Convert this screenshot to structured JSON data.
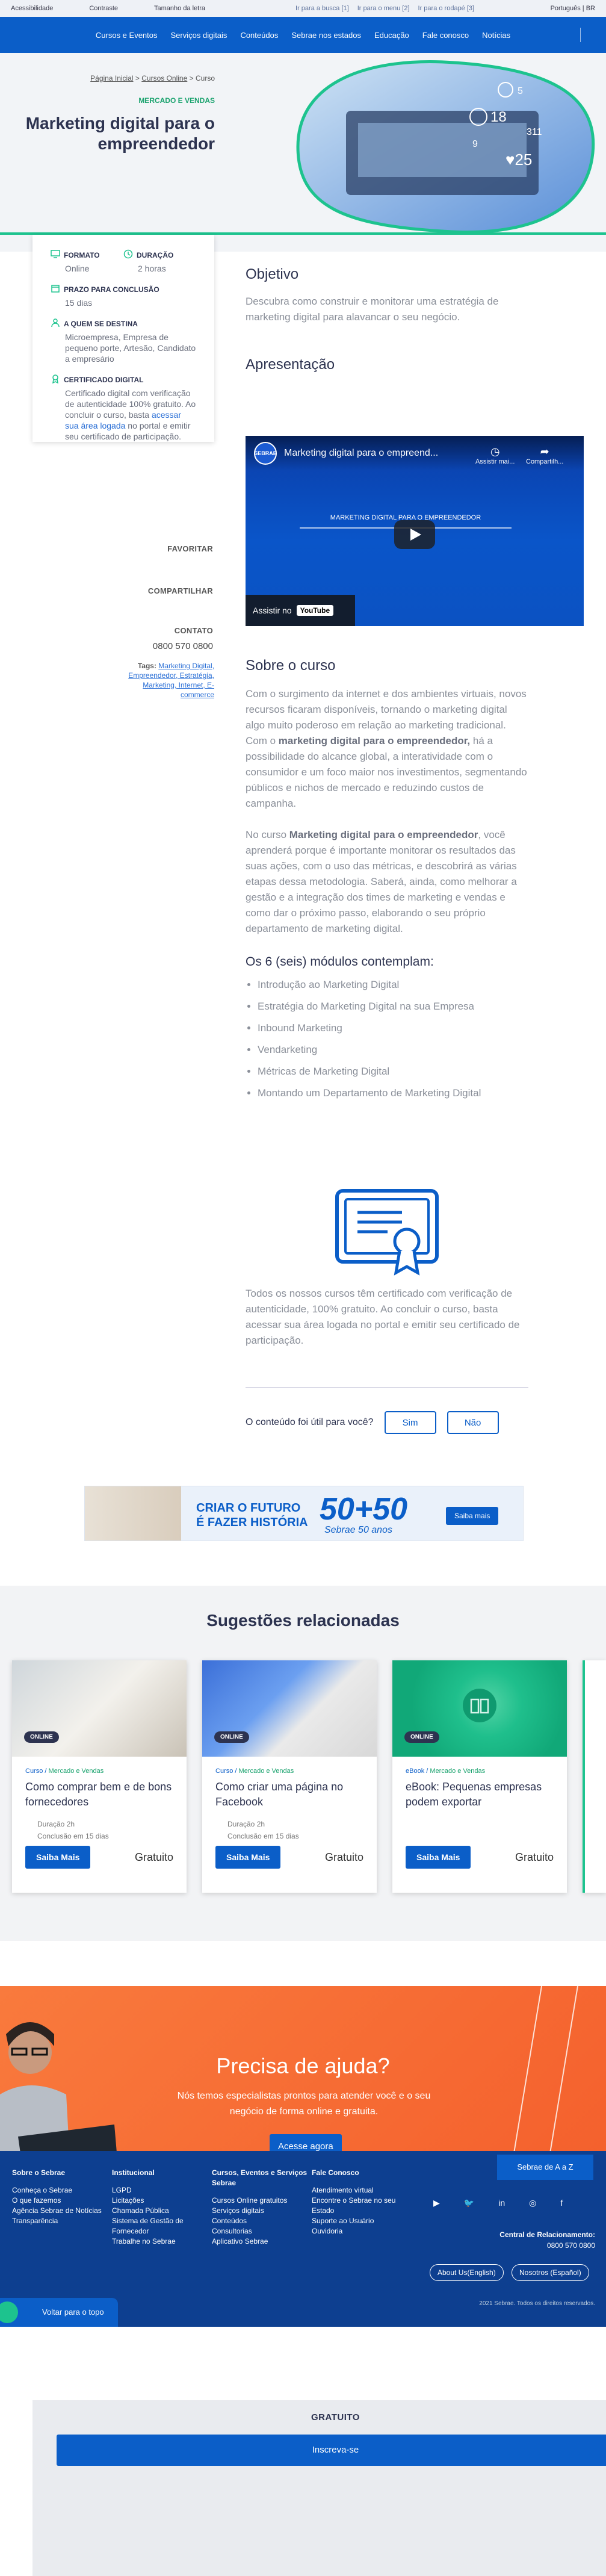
{
  "a11y": {
    "accessibility": "Acessibilidade",
    "contrast": "Contraste",
    "font_size": "Tamanho da letra",
    "skip_search": "Ir para a busca [1]",
    "skip_menu": "Ir para o menu [2]",
    "skip_footer": "Ir para o rodapé [3]",
    "language": "Português | BR"
  },
  "nav": [
    "Cursos e Eventos",
    "Serviços digitais",
    "Conteúdos",
    "Sebrae nos estados",
    "Educação",
    "Fale conosco",
    "Notícias"
  ],
  "hero": {
    "breadcrumb_home": "Página Inicial",
    "breadcrumb_courses": "Cursos Online",
    "breadcrumb_sep": ">",
    "breadcrumb_current": "Curso",
    "category": "MERCADO E VENDAS",
    "title": "Marketing digital para o empreendedor"
  },
  "info": {
    "format_label": "FORMATO",
    "format_value": "Online",
    "duration_label": "DURAÇÃO",
    "duration_value": "2 horas",
    "deadline_label": "PRAZO PARA CONCLUSÃO",
    "deadline_value": "15 dias",
    "audience_label": "A QUEM SE DESTINA",
    "audience_value": "Microempresa, Empresa de pequeno porte, Artesão, Candidato a empresário",
    "cert_label": "CERTIFICADO DIGITAL",
    "cert_text_1": "Certificado digital com verificação de autenticidade 100% gratuito. Ao concluir o curso, basta ",
    "cert_link": "acessar sua área logada",
    "cert_text_2": " no portal e emitir seu certificado de participação.",
    "price": "GRATUITO",
    "cta": "Inscreva-se"
  },
  "side": {
    "favorite": "FAVORITAR",
    "share": "COMPARTILHAR",
    "contact": "CONTATO",
    "phone": "0800 570 0800",
    "tags_label": "Tags:",
    "tags": "Marketing Digital, Empreendedor, Estratégia, Marketing, Internet, E-commerce"
  },
  "content": {
    "objective_title": "Objetivo",
    "objective_text": "Descubra como construir e monitorar uma estratégia de marketing digital para alavancar o seu negócio.",
    "presentation_title": "Apresentação",
    "video_title": "Marketing digital para o empreend...",
    "video_watch_later": "Assistir mai...",
    "video_share": "Compartilh...",
    "video_center_text": "MARKETING DIGITAL PARA O EMPREENDEDOR",
    "video_watch_on": "Assistir no",
    "video_youtube": "YouTube",
    "about_title": "Sobre o curso",
    "about_p1_a": "Com o surgimento da internet e dos ambientes virtuais, novos recursos ficaram disponíveis, tornando o marketing digital algo muito poderoso em relação ao marketing tradicional. Com o ",
    "about_p1_b": "marketing digital para o empreendedor,",
    "about_p1_c": " há a possibilidade do alcance global, a interatividade com o consumidor e um foco maior nos investimentos, segmentando públicos e nichos de mercado e reduzindo custos de campanha.",
    "about_p2_a": "No curso ",
    "about_p2_b": "Marketing digital para o empreendedor",
    "about_p2_c": ", você aprenderá porque é importante monitorar os resultados das suas ações, com o uso das métricas, e descobrirá as várias etapas dessa metodologia. Saberá, ainda, como melhorar a gestão e a integração dos times de marketing e vendas e como dar o próximo passo, elaborando o seu próprio departamento de marketing digital.",
    "modules_title": "Os 6 (seis) módulos contemplam:",
    "modules": [
      "Introdução ao Marketing Digital",
      "Estratégia do Marketing Digital na sua Empresa",
      "Inbound Marketing",
      "Vendarketing",
      "Métricas de Marketing Digital",
      "Montando um Departamento de Marketing Digital"
    ],
    "cert_text": "Todos os nossos cursos têm certificado com verificação de autenticidade, 100% gratuito. Ao concluir o curso, basta acessar sua área logada no portal e emitir seu certificado de participação."
  },
  "feedback": {
    "question": "O conteúdo foi útil para você?",
    "yes": "Sim",
    "no": "Não"
  },
  "banner": {
    "line1": "CRIAR O FUTURO",
    "line2": "É FAZER HISTÓRIA",
    "big": "50+50",
    "sub": "Sebrae 50 anos",
    "cta": "Saiba mais"
  },
  "suggestions": {
    "title": "Sugestões relacionadas",
    "cards": [
      {
        "badge": "ONLINE",
        "type": "Curso",
        "sep": "/",
        "cat": "Mercado e Vendas",
        "title": "Como comprar bem e de bons fornecedores",
        "duration": "Duração 2h",
        "deadline": "Conclusão em 15 dias",
        "cta": "Saiba Mais",
        "price": "Gratuito"
      },
      {
        "badge": "ONLINE",
        "type": "Curso",
        "sep": "/",
        "cat": "Mercado e Vendas",
        "title": "Como criar uma página no Facebook",
        "duration": "Duração 2h",
        "deadline": "Conclusão em 15 dias",
        "cta": "Saiba Mais",
        "price": "Gratuito"
      },
      {
        "badge": "ONLINE",
        "type": "eBook",
        "sep": "/",
        "cat": "Mercado e Vendas",
        "title": "eBook: Pequenas empresas podem exportar",
        "duration": "",
        "deadline": "",
        "cta": "Saiba Mais",
        "price": "Gratuito"
      }
    ]
  },
  "help": {
    "title": "Precisa de ajuda?",
    "text": "Nós temos especialistas prontos para atender você e o seu negócio de forma online e gratuita.",
    "cta": "Acesse agora"
  },
  "footer": {
    "az": "Sebrae de A a Z",
    "cols": [
      {
        "title": "Sobre o Sebrae",
        "items": [
          "Conheça o Sebrae",
          "O que fazemos",
          "Agência Sebrae de Notícias",
          "Transparência"
        ]
      },
      {
        "title": "Institucional",
        "items": [
          "LGPD",
          "Licitações",
          "Chamada Pública",
          "Sistema de Gestão de Fornecedor",
          "Trabalhe no Sebrae"
        ]
      },
      {
        "title": "Cursos, Eventos e Serviços Sebrae",
        "items": [
          "Cursos Online gratuitos",
          "Serviços digitais",
          "Conteúdos",
          "Consultorias",
          "Aplicativo Sebrae"
        ]
      },
      {
        "title": "Fale Conosco",
        "items": [
          "Atendimento virtual",
          "Encontre o Sebrae no seu Estado",
          "Suporte ao Usuário",
          "Ouvidoria"
        ]
      }
    ],
    "social": [
      "▶",
      "🐦",
      "in",
      "◎",
      "f"
    ],
    "rel_title": "Central de Relacionamento:",
    "rel_phone": "0800 570 0800",
    "lang_en": "About Us(English)",
    "lang_es": "Nosotros (Español)",
    "copyright": "2021 Sebrae. Todos os direitos reservados.",
    "to_top": "Voltar para o topo"
  }
}
